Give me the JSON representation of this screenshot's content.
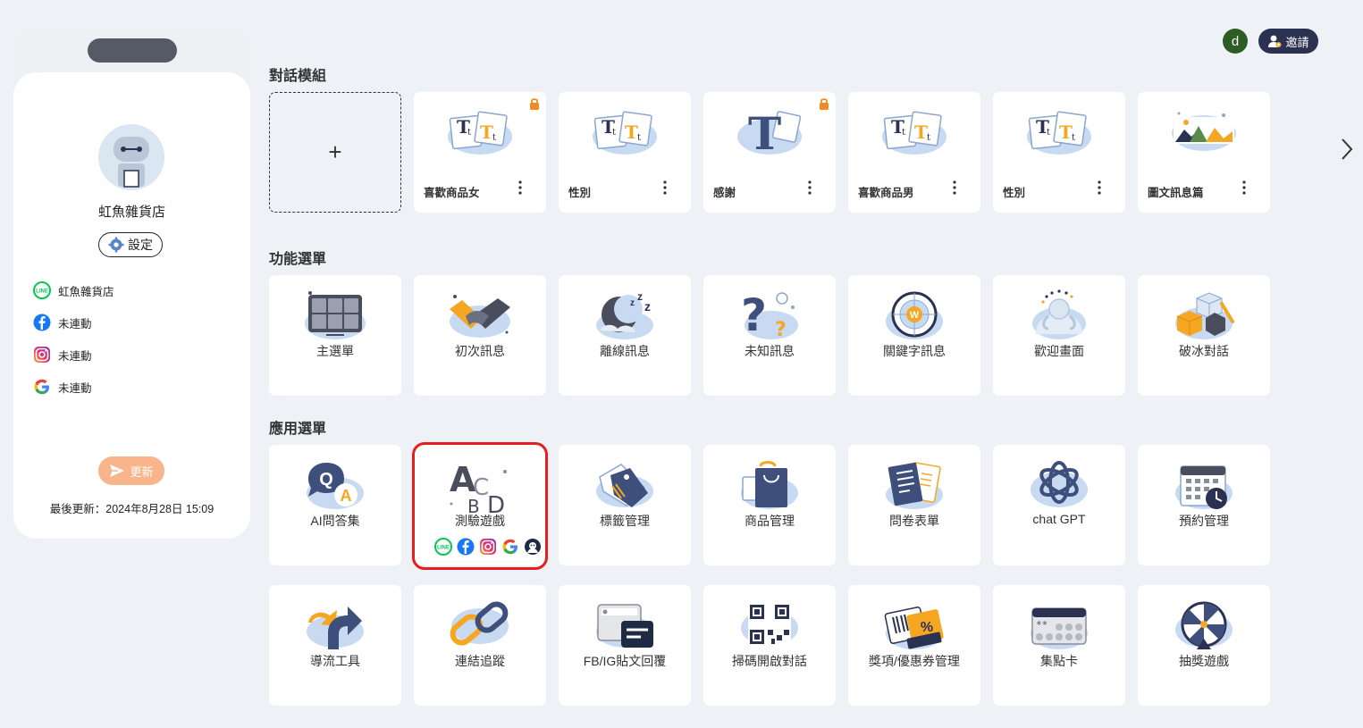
{
  "header": {
    "avatar_letter": "d",
    "invite_label": "邀請"
  },
  "sidebar": {
    "shop_name": "虹魚雜貨店",
    "settings_label": "設定",
    "channels": [
      {
        "icon": "line-icon",
        "label": "虹魚雜貨店"
      },
      {
        "icon": "facebook-icon",
        "label": "未連動"
      },
      {
        "icon": "instagram-icon",
        "label": "未連動"
      },
      {
        "icon": "google-icon",
        "label": "未連動"
      }
    ],
    "update_label": "更新",
    "last_update": "最後更新：2024年8月28日 15:09"
  },
  "sections": {
    "templates": {
      "title": "對話模組",
      "add_label": "+",
      "items": [
        {
          "label": "喜歡商品女",
          "locked": true
        },
        {
          "label": "性別",
          "locked": false
        },
        {
          "label": "感謝",
          "locked": true
        },
        {
          "label": "喜歡商品男",
          "locked": false
        },
        {
          "label": "性別",
          "locked": false
        },
        {
          "label": "圖文訊息篇",
          "locked": false
        }
      ]
    },
    "functions": {
      "title": "功能選單",
      "items": [
        {
          "label": "主選單",
          "icon": "grid-menu-icon"
        },
        {
          "label": "初次訊息",
          "icon": "handshake-icon"
        },
        {
          "label": "離線訊息",
          "icon": "moon-sleep-icon"
        },
        {
          "label": "未知訊息",
          "icon": "question-mark-icon"
        },
        {
          "label": "關鍵字訊息",
          "icon": "keyword-target-icon"
        },
        {
          "label": "歡迎畫面",
          "icon": "welcome-person-icon"
        },
        {
          "label": "破冰對話",
          "icon": "ice-cubes-icon"
        }
      ]
    },
    "applications": {
      "title": "應用選單",
      "row1": [
        {
          "label": "AI問答集",
          "icon": "qa-bubble-icon"
        },
        {
          "label": "測驗遊戲",
          "icon": "abcd-quiz-icon"
        },
        {
          "label": "標籤管理",
          "icon": "tag-icon"
        },
        {
          "label": "商品管理",
          "icon": "shopping-bag-icon"
        },
        {
          "label": "問卷表單",
          "icon": "survey-form-icon"
        },
        {
          "label": "chat GPT",
          "icon": "openai-icon"
        },
        {
          "label": "預約管理",
          "icon": "calendar-clock-icon"
        }
      ],
      "row2": [
        {
          "label": "導流工具",
          "icon": "redirect-arrow-icon"
        },
        {
          "label": "連結追蹤",
          "icon": "chain-link-icon"
        },
        {
          "label": "FB/IG貼文回覆",
          "icon": "post-reply-icon"
        },
        {
          "label": "掃碼開啟對話",
          "icon": "qr-code-icon"
        },
        {
          "label": "獎項/優惠券管理",
          "icon": "coupon-icon"
        },
        {
          "label": "集點卡",
          "icon": "point-card-icon"
        },
        {
          "label": "抽獎遊戲",
          "icon": "prize-wheel-icon"
        }
      ]
    }
  },
  "colors": {
    "accent": "#f5a623",
    "navy": "#2a3151",
    "highlight": "#e61e1e",
    "blob": "#c7daf2",
    "line_green": "#06c755",
    "facebook_blue": "#1877f2",
    "update_button": "#f8b48a"
  }
}
